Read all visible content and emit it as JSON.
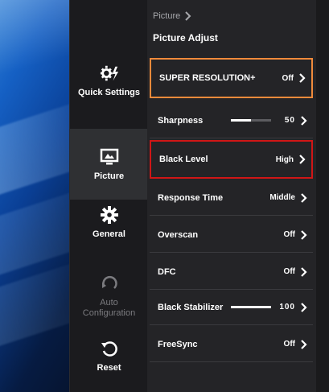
{
  "breadcrumb": {
    "label": "Picture"
  },
  "section": {
    "title": "Picture Adjust"
  },
  "sidebar": {
    "items": [
      {
        "label": "Quick Settings",
        "icon": "quick-settings-icon",
        "active": false,
        "enabled": true
      },
      {
        "label": "Picture",
        "icon": "picture-icon",
        "active": true,
        "enabled": true
      },
      {
        "label": "General",
        "icon": "gear-icon",
        "active": false,
        "enabled": true
      },
      {
        "label": "Auto Configuration",
        "icon": "auto-configuration-icon",
        "active": false,
        "enabled": false
      },
      {
        "label": "Reset",
        "icon": "reset-icon",
        "active": false,
        "enabled": true
      }
    ]
  },
  "settings": [
    {
      "label": "SUPER RESOLUTION+",
      "value": "Off"
    },
    {
      "label": "Sharpness",
      "value": "50",
      "level": 50
    },
    {
      "label": "Black Level",
      "value": "High"
    },
    {
      "label": "Response Time",
      "value": "Middle"
    },
    {
      "label": "Overscan",
      "value": "Off"
    },
    {
      "label": "DFC",
      "value": "Off"
    },
    {
      "label": "Black Stabilizer",
      "value": "100",
      "level": 100
    },
    {
      "label": "FreeSync",
      "value": "Off"
    }
  ],
  "colors": {
    "focus_orange": "#f08a3b",
    "focus_red": "#d01616",
    "panel": "#242427",
    "sidebar": "#1b1b1e"
  }
}
